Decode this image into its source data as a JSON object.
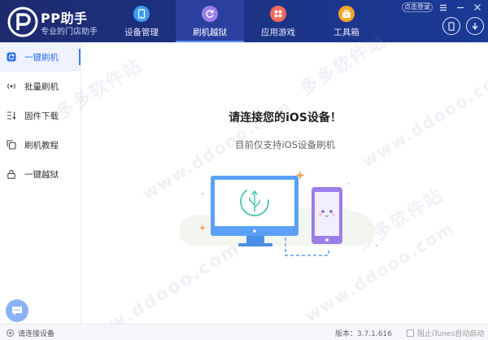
{
  "brand": {
    "name": "PP助手",
    "subtitle": "专业的门店助手"
  },
  "top_tabs": [
    {
      "label": "设备管理",
      "icon": "tablet-icon",
      "color": "#3a9af0"
    },
    {
      "label": "刷机越狱",
      "icon": "refresh-icon",
      "color": "#9b7ee8",
      "active": true
    },
    {
      "label": "应用游戏",
      "icon": "apps-grid-icon",
      "color": "#f26b5b"
    },
    {
      "label": "工具箱",
      "icon": "toolbox-icon",
      "color": "#f5a524"
    }
  ],
  "header": {
    "login_label": "点击登录"
  },
  "sidebar": {
    "items": [
      {
        "label": "一键刷机",
        "icon": "flash-icon",
        "active": true
      },
      {
        "label": "批量刷机",
        "icon": "broadcast-icon"
      },
      {
        "label": "固件下载",
        "icon": "download-list-icon"
      },
      {
        "label": "刷机教程",
        "icon": "copy-docs-icon"
      },
      {
        "label": "一键越狱",
        "icon": "lock-icon"
      }
    ]
  },
  "main": {
    "headline": "请连接您的iOS设备！",
    "subline": "目前仅支持iOS设备刷机"
  },
  "watermark": {
    "text": "多多软件站",
    "url": "www.ddooo.com"
  },
  "status": {
    "connection": "请连接设备",
    "version": "版本：3.7.1.616",
    "itunes_label": "阻止iTunes自动启动"
  },
  "colors": {
    "topbar": "#1c3385",
    "accent": "#2c6df0",
    "illustration": "#5aa0f5",
    "phone": "#9b7ee8"
  }
}
